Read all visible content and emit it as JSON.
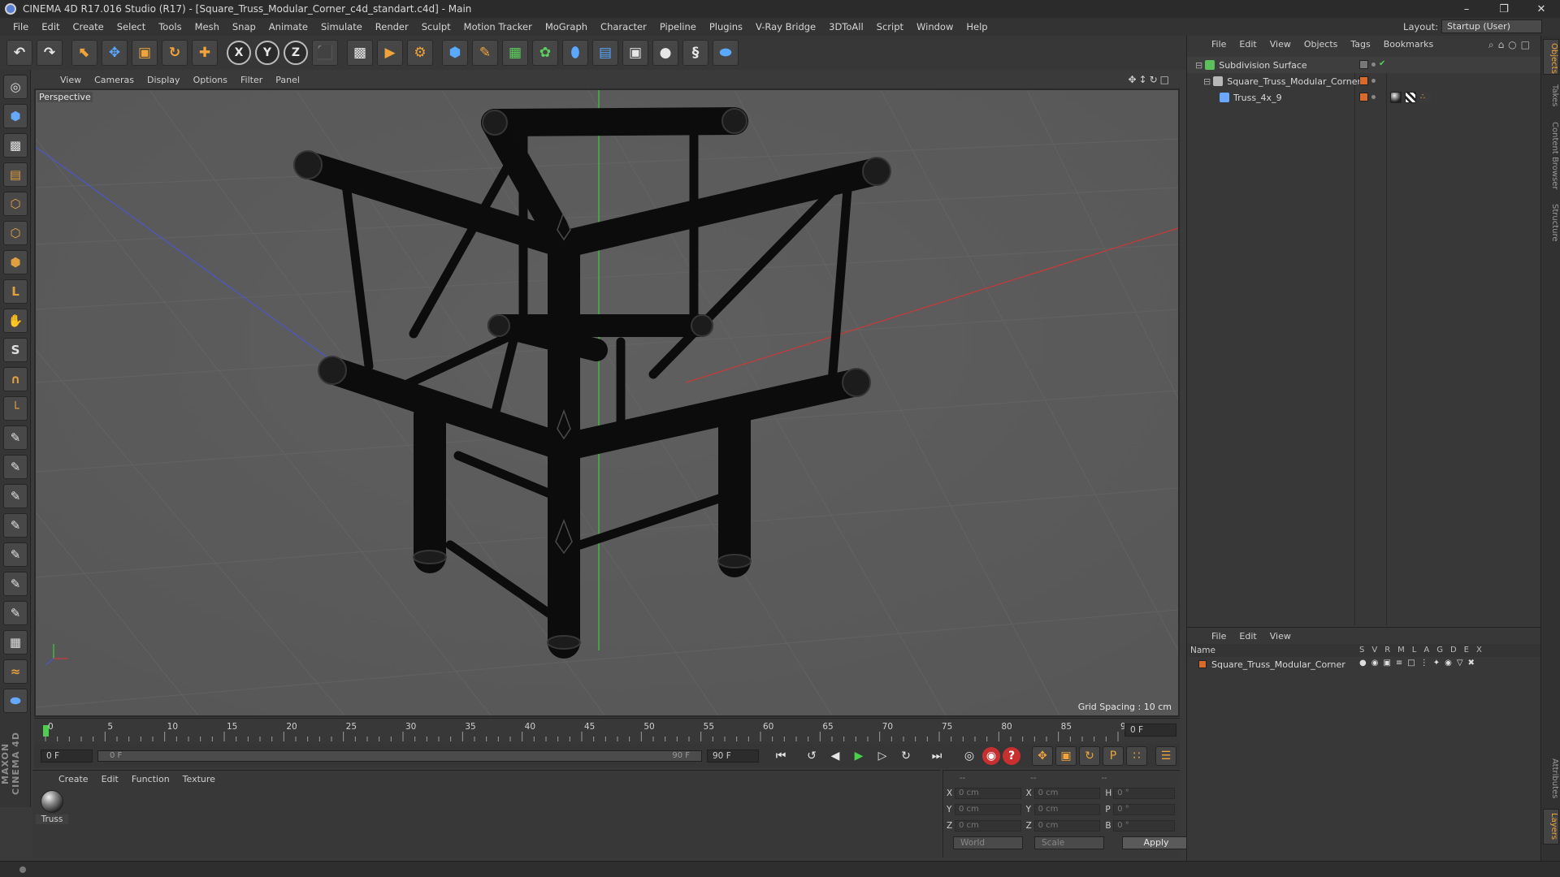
{
  "title": "CINEMA 4D R17.016 Studio (R17) - [Square_Truss_Modular_Corner_c4d_standart.c4d] - Main",
  "window_controls": {
    "minimize": "–",
    "maximize": "❐",
    "close": "✕"
  },
  "menu": [
    "File",
    "Edit",
    "Create",
    "Select",
    "Tools",
    "Mesh",
    "Snap",
    "Animate",
    "Simulate",
    "Render",
    "Sculpt",
    "Motion Tracker",
    "MoGraph",
    "Character",
    "Pipeline",
    "Plugins",
    "V-Ray Bridge",
    "3DToAll",
    "Script",
    "Window",
    "Help"
  ],
  "layout": {
    "label": "Layout:",
    "value": "Startup (User)"
  },
  "toolbar": {
    "undo_icon": "↶",
    "redo_icon": "↷",
    "axis_x": "X",
    "axis_y": "Y",
    "axis_z": "Z"
  },
  "viewport": {
    "menu": [
      "View",
      "Cameras",
      "Display",
      "Options",
      "Filter",
      "Panel"
    ],
    "nav_icons": "✥↕↻□",
    "label": "Perspective",
    "grid_spacing": "Grid Spacing : 10 cm"
  },
  "timeline": {
    "ticks": [
      "0",
      "5",
      "10",
      "15",
      "20",
      "25",
      "30",
      "35",
      "40",
      "45",
      "50",
      "55",
      "60",
      "65",
      "70",
      "75",
      "80",
      "85",
      "90"
    ],
    "current_frame": "0 F"
  },
  "transport": {
    "start_field": "0 F",
    "slider_start": "0 F",
    "slider_end": "90 F",
    "end_field": "90 F"
  },
  "materials": {
    "menu": [
      "Create",
      "Edit",
      "Function",
      "Texture"
    ],
    "items": [
      {
        "name": "Truss"
      }
    ]
  },
  "coordinates": {
    "head": [
      "--",
      "--",
      "--"
    ],
    "rows": [
      {
        "a1": "X",
        "v1": "0 cm",
        "a2": "X",
        "v2": "0 cm",
        "a3": "H",
        "v3": "0 °"
      },
      {
        "a1": "Y",
        "v1": "0 cm",
        "a2": "Y",
        "v2": "0 cm",
        "a3": "P",
        "v3": "0 °"
      },
      {
        "a1": "Z",
        "v1": "0 cm",
        "a2": "Z",
        "v2": "0 cm",
        "a3": "B",
        "v3": "0 °"
      }
    ],
    "mode": "World",
    "transform": "Scale",
    "apply_label": "Apply"
  },
  "objects": {
    "menu": [
      "File",
      "Edit",
      "View",
      "Objects",
      "Tags",
      "Bookmarks"
    ],
    "icons": "⌕⌂○□",
    "items": [
      {
        "name": "Subdivision Surface",
        "indent": 0,
        "icon_color": "#5cc05c"
      },
      {
        "name": "Square_Truss_Modular_Corner",
        "indent": 1,
        "icon_color": "#b8b8b8"
      },
      {
        "name": "Truss_4x_9",
        "indent": 2,
        "icon_color": "#6aa8ff"
      }
    ]
  },
  "layers": {
    "menu": [
      "File",
      "Edit",
      "View"
    ],
    "header_name": "Name",
    "columns": [
      "S",
      "V",
      "R",
      "M",
      "L",
      "A",
      "G",
      "D",
      "E",
      "X"
    ],
    "items": [
      {
        "name": "Square_Truss_Modular_Corner"
      }
    ]
  },
  "side_tabs": [
    "Objects",
    "Takes",
    "Content Browser",
    "Structure",
    "Attributes",
    "Layers"
  ],
  "brand": "MAXON CINEMA 4D",
  "colors": {
    "viewport_bg": "#5b5b5b",
    "accent_orange": "#d86a2c",
    "axis_green": "#3acd3a",
    "axis_red": "#c83a3a",
    "axis_blue": "#4a58c8"
  }
}
